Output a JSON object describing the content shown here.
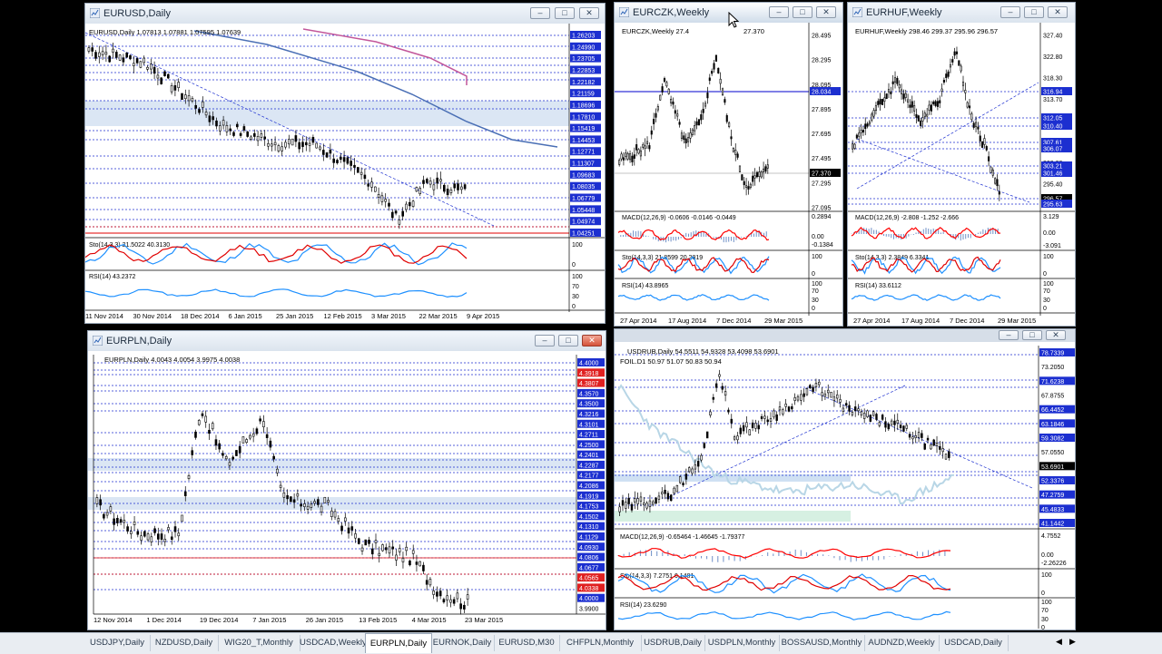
{
  "windows": {
    "eurusd": {
      "title": "EURUSD,Daily",
      "header": "EURUSD,Daily  1.07813 1.07881 1.07595 1.07639",
      "price_labels": [
        "1.26203",
        "1.24990",
        "1.23705",
        "1.22853",
        "1.22182",
        "1.21159",
        "1.18696",
        "1.17810",
        "1.15419",
        "1.14453",
        "1.12771",
        "1.11307",
        "1.09683",
        "1.08035",
        "1.06779",
        "1.05448",
        "1.04974",
        "1.04251"
      ],
      "sto_label": "Sto(14,3,3) 21.5022 40.3130",
      "sto_axis": [
        "100",
        "0"
      ],
      "rsi_label": "RSI(14) 43.2372",
      "rsi_axis": [
        "100",
        "70",
        "30",
        "0"
      ],
      "dates": [
        "11 Nov 2014",
        "30 Nov 2014",
        "18 Dec 2014",
        "6 Jan 2015",
        "25 Jan 2015",
        "12 Feb 2015",
        "3 Mar 2015",
        "22 Mar 2015",
        "9 Apr 2015"
      ]
    },
    "eurczk": {
      "title": "EURCZK,Weekly",
      "header": "EURCZK,Weekly  27.4",
      "header2": "27.370",
      "price_labels": [
        "28.495",
        "28.295",
        "28.095",
        "27.895",
        "27.695",
        "27.495",
        "27.295",
        "27.095"
      ],
      "hl_labels": [
        "28.034",
        "27.370"
      ],
      "macd_label": "MACD(12,26,9) -0.0606 -0.0146 -0.0449",
      "macd_axis": [
        "0.2894",
        "0.00",
        "-0.1384"
      ],
      "sto_label": "Sto(14,3,3) 21.8599 20.2819",
      "sto_axis": [
        "100",
        "0"
      ],
      "rsi_label": "RSI(14) 43.8965",
      "rsi_axis": [
        "100",
        "70",
        "30",
        "0"
      ],
      "dates": [
        "27 Apr 2014",
        "17 Aug 2014",
        "7 Dec 2014",
        "29 Mar 2015"
      ]
    },
    "eurhuf": {
      "title": "EURHUF,Weekly",
      "header": "EURHUF,Weekly  298.46 299.37 295.96 296.57",
      "price_labels": [
        "327.40",
        "322.80",
        "318.30",
        "313.70",
        "309.10",
        "304.60",
        "300.00",
        "295.40"
      ],
      "hl_labels": [
        "316.94",
        "312.05",
        "310.40",
        "307.61",
        "306.07",
        "303.21",
        "301.46",
        "296.57",
        "295.63"
      ],
      "macd_label": "MACD(12,26,9) -2.808 -1.252 -2.666",
      "macd_axis": [
        "3.129",
        "0.00",
        "-3.091"
      ],
      "sto_label": "Sto(14,3,3) 2.3849 6.3341",
      "sto_axis": [
        "100",
        "0"
      ],
      "rsi_label": "RSI(14) 33.6112",
      "rsi_axis": [
        "100",
        "70",
        "30",
        "0"
      ],
      "dates": [
        "27 Apr 2014",
        "17 Aug 2014",
        "7 Dec 2014",
        "29 Mar 2015"
      ]
    },
    "eurpln": {
      "title": "EURPLN,Daily",
      "header": "EURPLN,Daily  4.0043 4.0054 3.9975 4.0038",
      "price_labels": [
        "4.4000",
        "4.3918",
        "4.3807",
        "4.3570",
        "4.3500",
        "4.3216",
        "4.3101",
        "4.2711",
        "4.2500",
        "4.2401",
        "4.2287",
        "4.2177",
        "4.2086",
        "4.1919",
        "4.1753",
        "4.1502",
        "4.1310",
        "4.1129",
        "4.0930",
        "4.0806",
        "4.0677",
        "4.0565",
        "4.0338",
        "4.0000",
        "3.9900"
      ],
      "dates": [
        "12 Nov 2014",
        "1 Dec 2014",
        "19 Dec 2014",
        "7 Jan 2015",
        "26 Jan 2015",
        "13 Feb 2015",
        "4 Mar 2015",
        "23 Mar 2015"
      ]
    },
    "usdrub": {
      "title": "USDRUB,Daily",
      "header": "USDRUB,Daily  54.5511 54.9328 53.4098 53.6901",
      "overlay": "FOIL.D1 50.97 51.07 50.83 50.94",
      "price_labels": [
        "78.7339",
        "73.2050",
        "71.6238",
        "67.8755",
        "66.4452",
        "63.1846",
        "59.3082",
        "57.0550",
        "53.6901",
        "52.3376",
        "47.2759",
        "45.4833",
        "41.1442"
      ],
      "macd_label": "MACD(12,26,9) -0.65464 -1.46645 -1.79377",
      "macd_axis": [
        "4.7552",
        "0.00",
        "-2.26226"
      ],
      "sto_label": "Sto(14,3,3) 7.2751 6.1481",
      "sto_axis": [
        "100",
        "0"
      ],
      "rsi_label": "RSI(14) 23.6290",
      "rsi_axis": [
        "100",
        "70",
        "30",
        "0"
      ]
    }
  },
  "tabs": [
    {
      "label": "USDJPY,Daily",
      "active": false
    },
    {
      "label": "NZDUSD,Daily",
      "active": false
    },
    {
      "label": "WIG20_T,Monthly",
      "active": false
    },
    {
      "label": "USDCAD,Weekly",
      "active": false
    },
    {
      "label": "EURPLN,Daily",
      "active": true
    },
    {
      "label": "EURNOK,Daily",
      "active": false
    },
    {
      "label": "EURUSD,M30",
      "active": false
    },
    {
      "label": "CHFPLN,Monthly",
      "active": false
    },
    {
      "label": "USDRUB,Daily",
      "active": false
    },
    {
      "label": "USDPLN,Monthly",
      "active": false
    },
    {
      "label": "BOSSAUSD,Monthly",
      "active": false
    },
    {
      "label": "AUDNZD,Weekly",
      "active": false
    },
    {
      "label": "USDCAD,Daily",
      "active": false
    }
  ],
  "icons": {
    "minimize": "minimize-icon",
    "restore": "restore-icon",
    "close": "close-icon",
    "chart": "chart-icon",
    "cursor": "arrow-cursor-icon"
  },
  "colors": {
    "bull": "#000000",
    "line_blue": "#0000cc",
    "red": "#e00000",
    "macd_sig": "#ff0000",
    "sto_blue": "#1e90ff",
    "label_blue": "#1c2fd0",
    "label_red": "#e02020",
    "ma_blue": "#4a6fb5",
    "ma_pink": "#c2569a"
  }
}
